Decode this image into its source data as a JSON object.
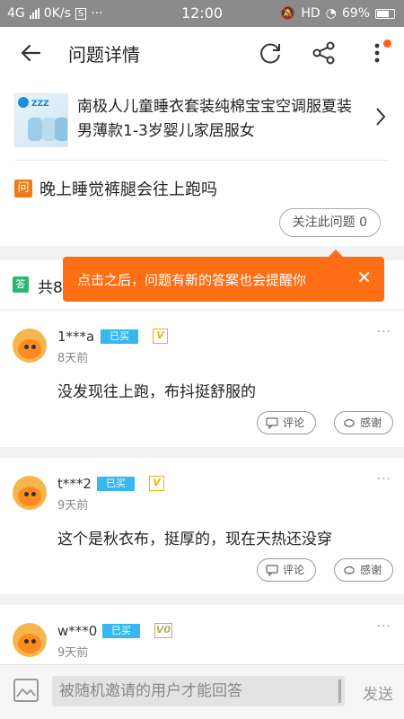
{
  "status_bar": {
    "network": "4G",
    "speed": "0K/s",
    "time": "12:00",
    "hd": "HD",
    "battery": "69%"
  },
  "header": {
    "title": "问题详情"
  },
  "product": {
    "title": "南极人儿童睡衣套装纯棉宝宝空调服夏装男薄款1-3岁婴儿家居服女"
  },
  "question": {
    "badge": "问",
    "text": "晚上睡觉裤腿会往上跑吗",
    "follow_label": "关注此问题 0"
  },
  "answers_header": {
    "badge": "答",
    "count_text": "共8"
  },
  "tooltip": {
    "text": "点击之后，问题有新的答案也会提醒你",
    "close": "✕"
  },
  "answers": [
    {
      "user": "1***a",
      "badge": "已买",
      "level": "V",
      "time": "8天前",
      "text": "没发现往上跑，布抖挺舒服的",
      "comment": "评论",
      "thanks": "感谢"
    },
    {
      "user": "t***2",
      "badge": "已买",
      "level": "V",
      "time": "9天前",
      "text": "这个是秋衣布，挺厚的，现在天热还没穿",
      "comment": "评论",
      "thanks": "感谢"
    },
    {
      "user": "w***0",
      "badge": "已买",
      "level": "V0",
      "time": "9天前"
    }
  ],
  "bottom_bar": {
    "placeholder": "被随机邀请的用户才能回答",
    "send": "发送"
  },
  "icons": {
    "back": "arrow-left-icon",
    "refresh": "refresh-icon",
    "share": "share-icon",
    "menu": "more-vertical-icon"
  },
  "colors": {
    "accent": "#ff6e15",
    "bought": "#35b7ef",
    "answer_badge": "#2bb673"
  }
}
